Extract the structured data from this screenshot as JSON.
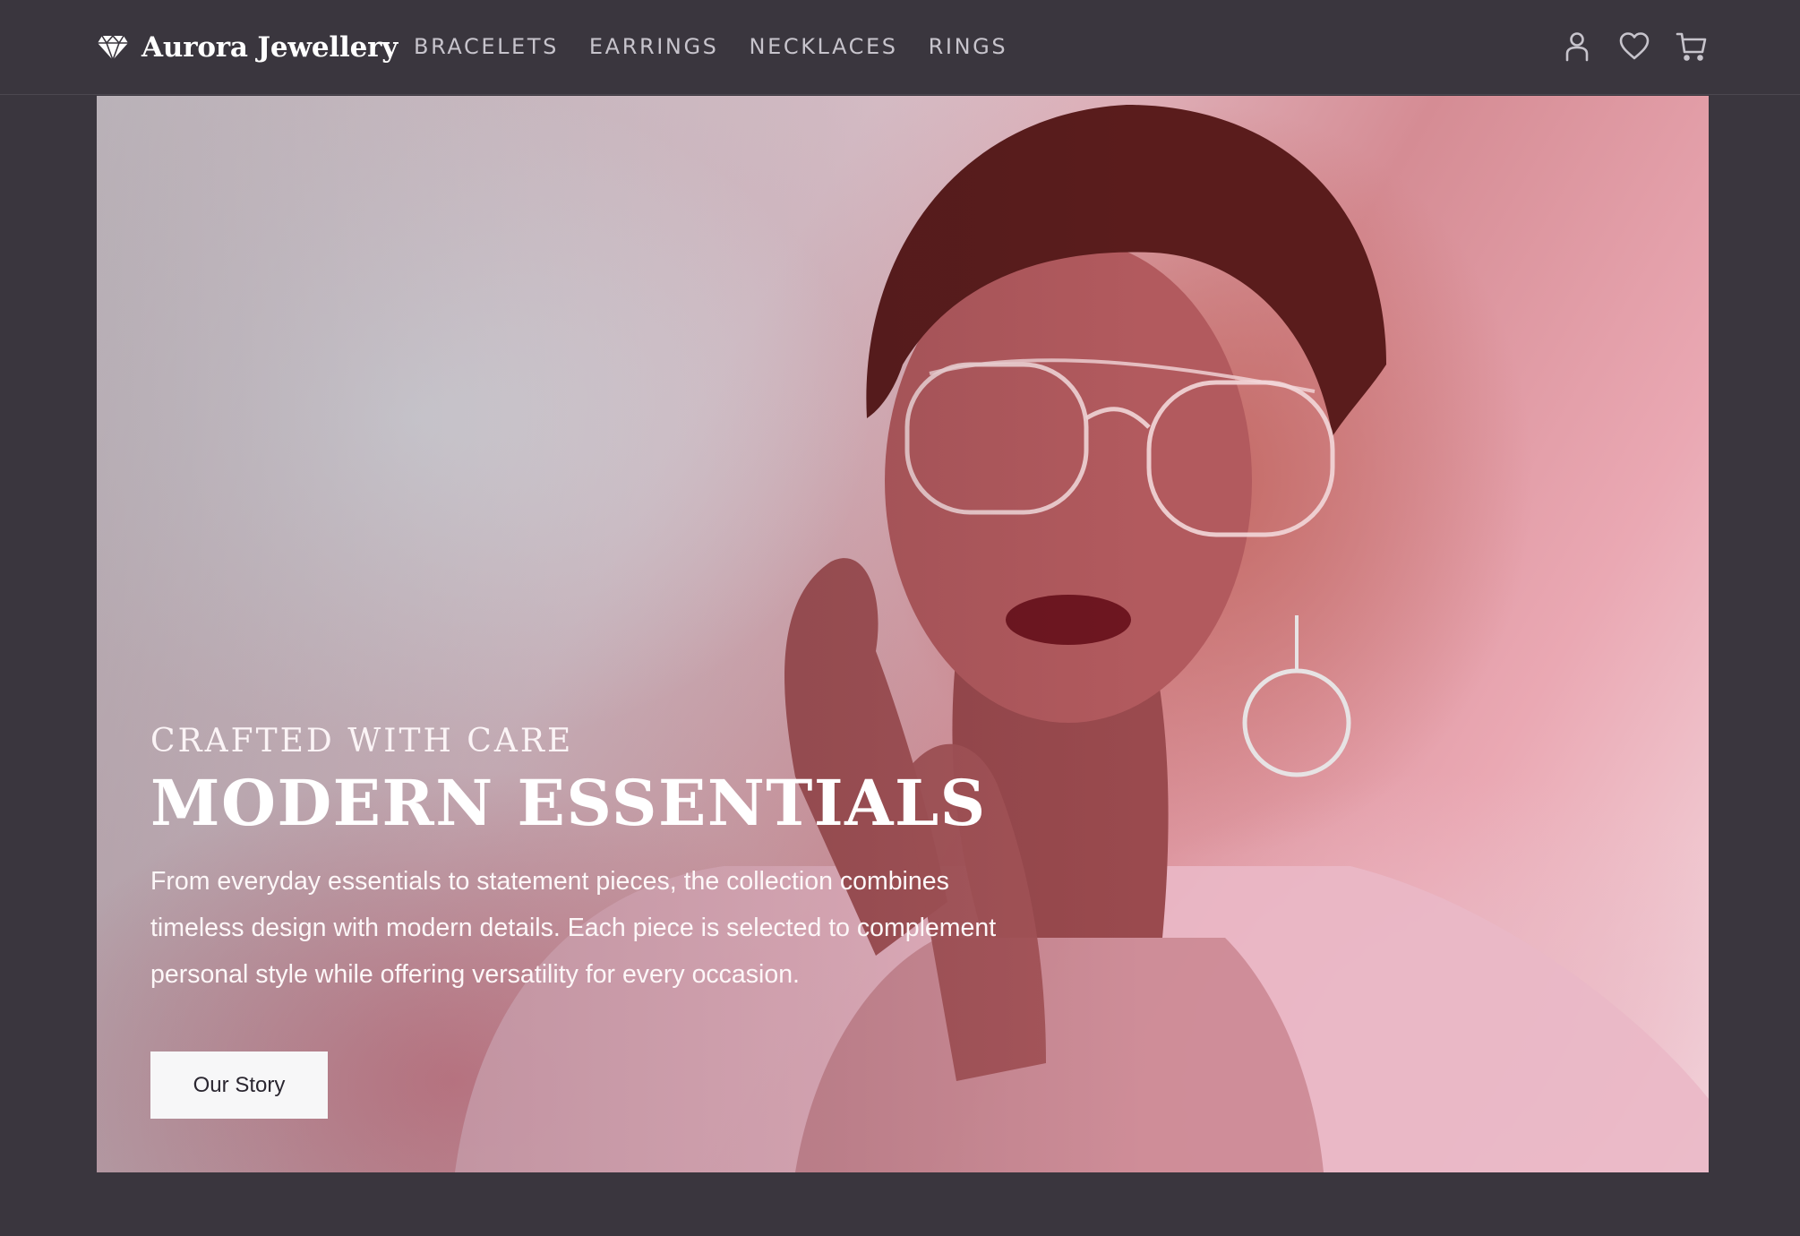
{
  "brand": {
    "name": "Aurora Jewellery",
    "logo_icon": "diamond-icon"
  },
  "nav": {
    "items": [
      {
        "label": "BRACELETS"
      },
      {
        "label": "EARRINGS"
      },
      {
        "label": "NECKLACES"
      },
      {
        "label": "RINGS"
      }
    ]
  },
  "header_icons": [
    "account-icon",
    "wishlist-heart-icon",
    "cart-icon"
  ],
  "hero": {
    "image_subject": "portrait of a woman with short curly hair, aviator glasses, hoop earrings and pink fur coat",
    "eyebrow": "CRAFTED WITH CARE",
    "headline": "MODERN ESSENTIALS",
    "body": "From everyday essentials to statement pieces, the collection combines timeless design with modern details. Each piece is selected to complement personal style while offering versatility for every occasion.",
    "cta_label": "Our Story"
  },
  "colors": {
    "background": "#3a363e",
    "nav_text": "#c7c4cc",
    "cta_background": "#f7f7f8",
    "cta_text": "#2a2630"
  }
}
